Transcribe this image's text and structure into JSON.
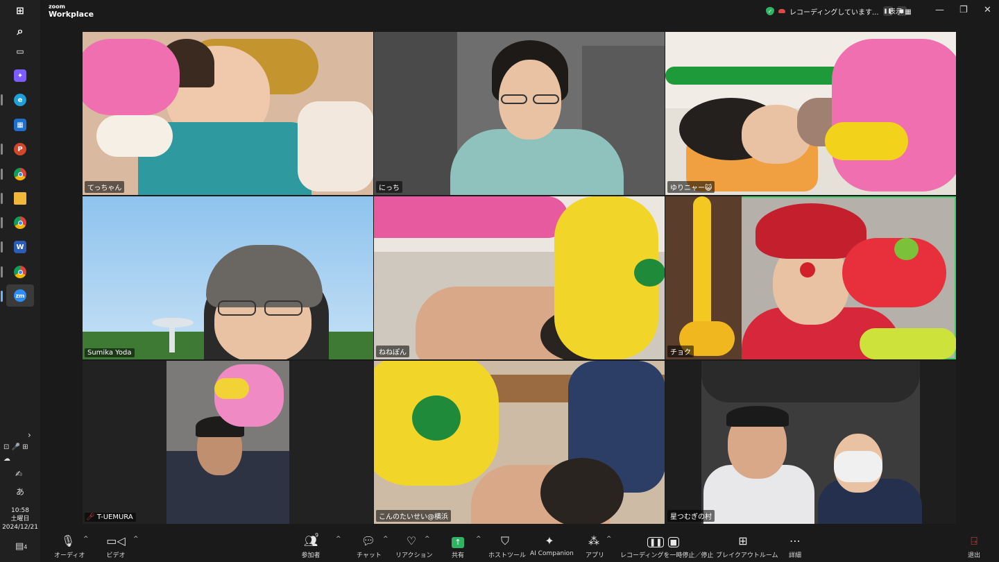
{
  "window": {
    "brand_small": "zoom",
    "brand_large": "Workplace",
    "recording_status": "レコーディングしています...",
    "view_label": "表示",
    "minimize_icon": "—",
    "maximize_icon": "❐",
    "close_icon": "✕"
  },
  "taskbar": {
    "apps": [
      {
        "name": "start",
        "glyph": "⊞",
        "color": "#0078d4"
      },
      {
        "name": "search",
        "glyph": "⌕",
        "color": "#202020"
      },
      {
        "name": "task-view",
        "glyph": "▭",
        "color": "#202020"
      },
      {
        "name": "copilot",
        "glyph": "✦",
        "color": "#7b5cff"
      },
      {
        "name": "edge",
        "glyph": "e",
        "color": "#1e9fd8"
      },
      {
        "name": "store",
        "glyph": "▦",
        "color": "#1f6fd1"
      },
      {
        "name": "powerpoint",
        "glyph": "P",
        "color": "#d2472a"
      },
      {
        "name": "chrome",
        "glyph": "◉",
        "color": "#e0b52c"
      },
      {
        "name": "explorer",
        "glyph": "▬",
        "color": "#f1b73a"
      },
      {
        "name": "chrome-2",
        "glyph": "◉",
        "color": "#d94a3a"
      },
      {
        "name": "word",
        "glyph": "W",
        "color": "#2b5cb8"
      },
      {
        "name": "chrome-3",
        "glyph": "◉",
        "color": "#3a9a4a"
      },
      {
        "name": "zoom",
        "glyph": "zm",
        "color": "#2d8cff"
      }
    ],
    "ime": "あ",
    "time": "10:58",
    "day": "土曜日",
    "date": "2024/12/21",
    "notifications": "4"
  },
  "participants": [
    {
      "name": "てっちゃん",
      "speaking": false
    },
    {
      "name": "にっち",
      "speaking": false
    },
    {
      "name": "ゆりニャー😺",
      "speaking": false
    },
    {
      "name": "Sumika Yoda",
      "speaking": false
    },
    {
      "name": "ねねぽん",
      "speaking": false
    },
    {
      "name": "チョク",
      "speaking": true
    },
    {
      "name": "T-UEMURA",
      "speaking": false,
      "muted": true
    },
    {
      "name": "こんのたいせい@横浜",
      "speaking": false
    },
    {
      "name": "星つむぎの村",
      "speaking": false
    }
  ],
  "toolbar": {
    "audio": "オーディオ",
    "video": "ビデオ",
    "participants": "参加者",
    "participant_count": "9",
    "chat": "チャット",
    "reactions": "リアクション",
    "share": "共有",
    "host_tools": "ホストツール",
    "ai_companion": "AI Companion",
    "apps": "アプリ",
    "recording_control": "レコーディングを一時停止／停止",
    "breakout": "ブレイクアウトルーム",
    "more": "詳細",
    "leave": "退出"
  }
}
